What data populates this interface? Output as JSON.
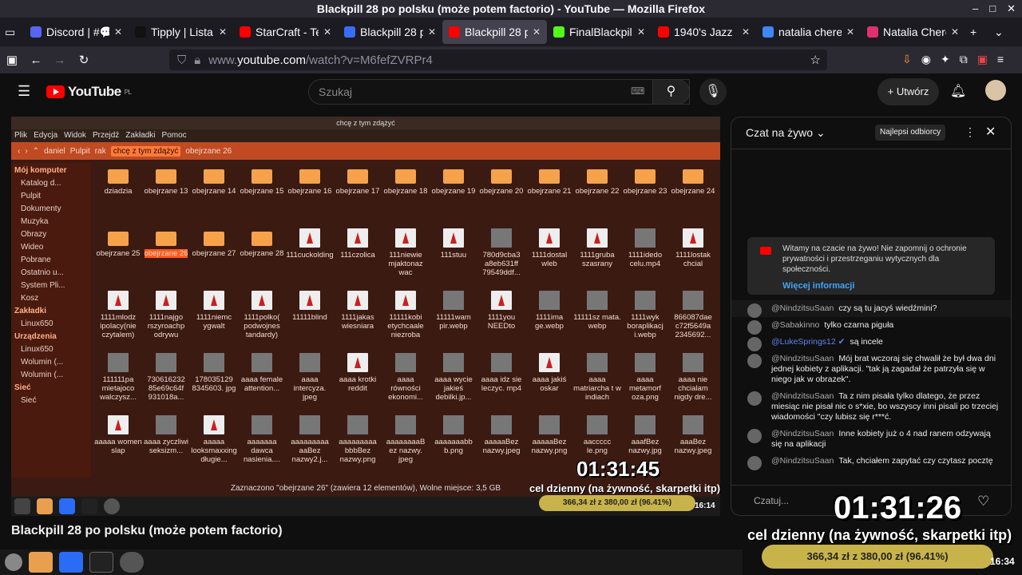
{
  "window": {
    "title": "Blackpill 28 po polsku (może potem factorio) - YouTube — Mozilla Firefox"
  },
  "tabs": [
    {
      "label": "Discord | #💬",
      "icon": "discord-icon",
      "color": "#5865f2"
    },
    {
      "label": "Tipply | Lista",
      "icon": "tipply-icon",
      "color": "#111111"
    },
    {
      "label": "StarCraft - Te",
      "icon": "youtube-icon",
      "color": "#ff0000"
    },
    {
      "label": "Blackpill 28 p",
      "icon": "blue-r-icon",
      "color": "#3b6cf5"
    },
    {
      "label": "Blackpill 28 p",
      "icon": "youtube-icon",
      "color": "#ff0000",
      "active": true
    },
    {
      "label": "FinalBlackpill",
      "icon": "k-icon",
      "color": "#53fc18"
    },
    {
      "label": "1940's Jazz",
      "icon": "youtube-icon",
      "color": "#ff0000"
    },
    {
      "label": "natalia chere",
      "icon": "google-icon",
      "color": "#4285f4"
    },
    {
      "label": "Natalia Chere",
      "icon": "instagram-icon",
      "color": "#e1306c"
    }
  ],
  "url": {
    "prefix": "www.",
    "domain": "youtube.com",
    "path": "/watch?v=M6fefZVRPr4"
  },
  "yt": {
    "logo": "YouTube",
    "region": "PL",
    "search_placeholder": "Szukaj",
    "create_label": "+ Utwórz"
  },
  "video": {
    "window_title": "chcę z tym zdążyć",
    "menu": [
      "Plik",
      "Edycja",
      "Widok",
      "Przejdź",
      "Zakładki",
      "Pomoc"
    ],
    "path": [
      "daniel",
      "Pulpit",
      "rak",
      "chcę z tym zdążyć",
      "obejrzane 26"
    ],
    "sidebar": {
      "h1": "Mój komputer",
      "items1": [
        "Katalog d...",
        "Pulpit",
        "Dokumenty",
        "Muzyka",
        "Obrazy",
        "Wideo",
        "Pobrane",
        "Ostatnio u...",
        "System Pli...",
        "Kosz"
      ],
      "h2": "Zakładki",
      "items2": [
        "Linux650"
      ],
      "h3": "Urządzenia",
      "items3": [
        "Linux650",
        "Wolumin (...",
        "Wolumin (..."
      ],
      "h4": "Sieć",
      "items4": [
        "Sieć"
      ]
    },
    "files": [
      {
        "n": "dziadzia",
        "t": "folder"
      },
      {
        "n": "obejrzane 13",
        "t": "folder"
      },
      {
        "n": "obejrzane 14",
        "t": "folder"
      },
      {
        "n": "obejrzane 15",
        "t": "folder"
      },
      {
        "n": "obejrzane 16",
        "t": "folder"
      },
      {
        "n": "obejrzane 17",
        "t": "folder"
      },
      {
        "n": "obejrzane 18",
        "t": "folder"
      },
      {
        "n": "obejrzane 19",
        "t": "folder"
      },
      {
        "n": "obejrzane 20",
        "t": "folder"
      },
      {
        "n": "obejrzane 21",
        "t": "folder"
      },
      {
        "n": "obejrzane 22",
        "t": "folder"
      },
      {
        "n": "obejrzane 23",
        "t": "folder"
      },
      {
        "n": "obejrzane 24",
        "t": "folder"
      },
      {
        "n": "obejrzane 25",
        "t": "folder"
      },
      {
        "n": "obejrzane 26",
        "t": "folder",
        "sel": true
      },
      {
        "n": "obejrzane 27",
        "t": "folder"
      },
      {
        "n": "obejrzane 28",
        "t": "folder"
      },
      {
        "n": "111cuckolding",
        "t": "file"
      },
      {
        "n": "111czolica",
        "t": "file"
      },
      {
        "n": "111niewie mjaktonaz wac",
        "t": "file"
      },
      {
        "n": "111stuu",
        "t": "file"
      },
      {
        "n": "780d9cba3 a8eb631ff 79549ddf...",
        "t": "img"
      },
      {
        "n": "1111dostal wleb",
        "t": "file"
      },
      {
        "n": "1111gruba szasrany",
        "t": "file"
      },
      {
        "n": "1111idedo celu.mp4",
        "t": "img"
      },
      {
        "n": "1111lostak chcial",
        "t": "file"
      },
      {
        "n": "1111mlodz ipolacy(nie czytalem)",
        "t": "file"
      },
      {
        "n": "1111najgo rszyroachp odrywu",
        "t": "file"
      },
      {
        "n": "1111niemc ygwalt",
        "t": "file"
      },
      {
        "n": "1111polko( podwojnes tandardy)",
        "t": "file"
      },
      {
        "n": "11111blind",
        "t": "file"
      },
      {
        "n": "1111jakas wiesniara",
        "t": "file"
      },
      {
        "n": "11111kobi etychcaale niezroba",
        "t": "file"
      },
      {
        "n": "11111wam pir.webp",
        "t": "img"
      },
      {
        "n": "1111you NEEDto",
        "t": "file"
      },
      {
        "n": "1111ima ge.webp",
        "t": "img"
      },
      {
        "n": "11111sz mata. webp",
        "t": "img"
      },
      {
        "n": "1111wyk boraplikacj i.webp",
        "t": "img"
      },
      {
        "n": "866087dae c72f5649a 2345692...",
        "t": "img"
      },
      {
        "n": "111111pa mietajoco walczysz...",
        "t": "img"
      },
      {
        "n": "730616232 85e69c64f 931018a...",
        "t": "img"
      },
      {
        "n": "178035129 8345603. jpg",
        "t": "img"
      },
      {
        "n": "aaaa female attention...",
        "t": "img"
      },
      {
        "n": "aaaa intercyza. jpeg",
        "t": "img"
      },
      {
        "n": "aaaa krotki reddit",
        "t": "file"
      },
      {
        "n": "aaaa równości ekonomi...",
        "t": "img"
      },
      {
        "n": "aaaa wycie jakieś debilki.jp...",
        "t": "img"
      },
      {
        "n": "aaaa idz sie leczyc. mp4",
        "t": "img"
      },
      {
        "n": "aaaa jakiś oskar",
        "t": "file"
      },
      {
        "n": "aaaa matriarcha t w indiach",
        "t": "img"
      },
      {
        "n": "aaaa metamorf oza.png",
        "t": "img"
      },
      {
        "n": "aaaa nie chcialam nigdy dre...",
        "t": "img"
      },
      {
        "n": "aaaaa women slap",
        "t": "file"
      },
      {
        "n": "aaaa zyczliwi seksizm...",
        "t": "img"
      },
      {
        "n": "aaaaa looksmaxxing długie...",
        "t": "file"
      },
      {
        "n": "aaaaaaa dawca nasienia....",
        "t": "img"
      },
      {
        "n": "aaaaaaaaa aaBez nazwy2.j...",
        "t": "img"
      },
      {
        "n": "aaaaaaaaa bbbBez nazwy.png",
        "t": "img"
      },
      {
        "n": "aaaaaaaaB ez nazwy. jpeg",
        "t": "img"
      },
      {
        "n": "aaaaaaabb b.png",
        "t": "img"
      },
      {
        "n": "aaaaaBez nazwy.jpeg",
        "t": "img"
      },
      {
        "n": "aaaaaBez nazwy.png",
        "t": "img"
      },
      {
        "n": "aaccccc le.png",
        "t": "img"
      },
      {
        "n": "aaafBez nazwy.jpg",
        "t": "img"
      },
      {
        "n": "aaaBez nazwy.jpeg",
        "t": "img"
      }
    ],
    "status": "Zaznaczono \"obejrzane 26\" (zawiera 12 elementów), Wolne miejsce: 3,5 GB",
    "timer": "01:31:45",
    "goal": "cel dzienny (na żywność, skarpetki itp)",
    "progress": "366,34 zł z 380,00 zł (96.41%)",
    "progress_fraction": 0.9641,
    "clock": "16:14"
  },
  "chat": {
    "title": "Czat na żywo",
    "top_fans": "Najlepsi odbiorcy",
    "welcome": "Witamy na czacie na żywo! Nie zapomnij o ochronie prywatności i przestrzeganiu wytycznych dla społeczności.",
    "more_info": "Więcej informacji",
    "messages": [
      {
        "author": "@NindzitsuSaan",
        "text": "czy są tu jacyś wiedźmini?"
      },
      {
        "author": "@Sabakinno",
        "text": "tylko czarna piguła"
      },
      {
        "author": "@LukeSprings12",
        "text": "są incele",
        "verified": true
      },
      {
        "author": "@NindzitsuSaan",
        "text": "Mój brat wczoraj się chwalił że był dwa dni jednej kobiety z aplikacji. \"tak ją zagadał że patrzyła się w niego jak w obrazek\"."
      },
      {
        "author": "@NindzitsuSaan",
        "text": "Ta z nim pisała tylko dlatego, że przez miesiąc nie pisał nic o s*xie, bo wszyscy inni pisali po trzeciej wiadomości \"czy lubisz się r***ć."
      },
      {
        "author": "@NindzitsuSaan",
        "text": "Inne kobiety już o 4 nad ranem odzywają się na aplikacji"
      },
      {
        "author": "@NindzitsuSaan",
        "text": "Tak, chciałem zapytać czy czytasz pocztę"
      }
    ],
    "input_placeholder": "Czatuj..."
  },
  "page": {
    "video_title": "Blackpill 28 po polsku (może potem factorio)",
    "overlay_timer": "01:31:26",
    "overlay_goal": "cel dzienny (na żywność, skarpetki itp)",
    "overlay_progress": "366,34 zł z 380,00 zł (96.41%)",
    "overlay_progress_fraction": 0.9641,
    "clock": "16:34"
  }
}
